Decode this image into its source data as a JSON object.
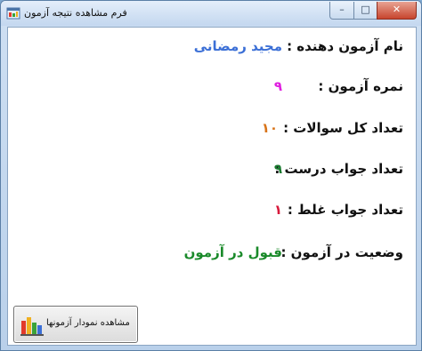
{
  "window": {
    "title": "فرم مشاهده نتیجه آزمون"
  },
  "controls": {
    "minimize": "–",
    "maximize": "□",
    "close": "✕"
  },
  "results": [
    {
      "label": "نام آزمون دهنده :",
      "value": "مجید رمضانی",
      "color": "#3b6fd6"
    },
    {
      "label": "نمره آزمون :",
      "value": "۹",
      "color": "#e020e0"
    },
    {
      "label": "تعداد کل سوالات :",
      "value": "۱۰",
      "color": "#d8741a"
    },
    {
      "label": "تعداد جواب درست :",
      "value": "۹",
      "color": "#1a7a30"
    },
    {
      "label": "تعداد جواب غلط :",
      "value": "۱",
      "color": "#d81a3c"
    },
    {
      "label": "وضعیت در آزمون :",
      "value": "قبول در آزمون",
      "color": "#1a8a2a"
    }
  ],
  "button": {
    "label": "مشاهده نمودار آزمونها",
    "icon": "bar-chart-icon"
  }
}
